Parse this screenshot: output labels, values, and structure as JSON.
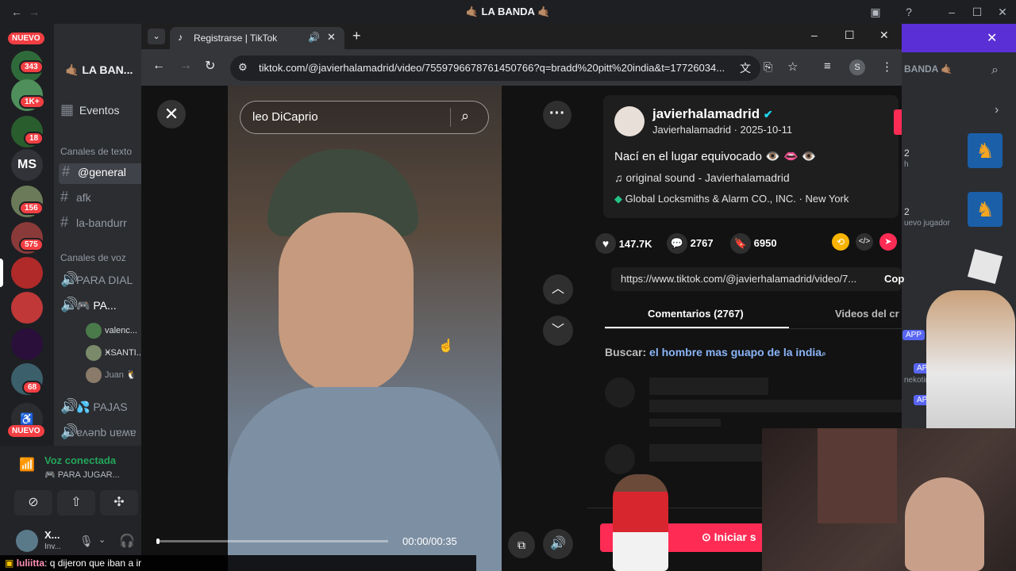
{
  "discord": {
    "title": "🤙🏽 LA BANDA 🤙🏽",
    "server_rail": {
      "nuevo_top": "NUEVO",
      "nuevo_bottom": "NUEVO",
      "badges": [
        "343",
        "1K+",
        "18",
        "156",
        "575",
        "68"
      ],
      "ms_label": "MS"
    },
    "sidebar": {
      "server_name": "🤙🏽 LA BAN...",
      "events": "Eventos",
      "text_category": "Canales de texto",
      "text_channels": [
        "@general",
        "afk",
        "la-bandurr"
      ],
      "voice_category": "Canales de voz",
      "voice_channels": [
        "PARA DIAL",
        "🎮 PA...",
        "💦 PAJAS",
        "ɐʌǝnb uɐʍɐ"
      ],
      "voice_users": [
        "valenc...",
        "ӾSANTI...",
        "Juan 🐧"
      ],
      "voice_connected": "Voz conectada",
      "voice_channel_sub": "🎮 PARA JUGAR...",
      "user_name": "X...",
      "user_status": "Inv..."
    },
    "right": {
      "banner": "BANDA 🤙🏽",
      "items": [
        "2",
        "h",
        "2",
        "uevo jugador",
        "nekotina.c..."
      ],
      "app_tags": [
        "APP",
        "APP",
        "APP"
      ]
    }
  },
  "browser": {
    "tab_title": "Registrarse | TikTok",
    "url": "tiktok.com/@javierhalamadrid/video/7559796678761450766?q=bradd%20pitt%20india&t=17726034...",
    "profile_initial": "S"
  },
  "tiktok": {
    "search_text": "leo DiCaprio",
    "timecode": "00:00/00:35",
    "username": "javierhalamadrid",
    "handle_date": "Javierhalamadrid · 2025-10-11",
    "caption": "Nací en el lugar equivocado 👁️ 👄 👁️",
    "sound": "original sound - Javierhalamadrid",
    "location": "Global Locksmiths & Alarm CO., INC. · New York",
    "likes": "147.7K",
    "comments": "2767",
    "saves": "6950",
    "share_url": "https://www.tiktok.com/@javierhalamadrid/video/7...",
    "copy_label": "Cop",
    "tab_comments": "Comentarios (2767)",
    "tab_videos": "Videos del cr",
    "search_prefix": "Buscar:",
    "search_suggestion": "el hombre mas guapo de la india",
    "live_button": "Iniciar s"
  },
  "chat": {
    "user": "luliitta",
    "message": ": q dijeron que iban a ir"
  },
  "colors": {
    "discord_bg": "#1e1f22",
    "discord_accent": "#5b2fd6",
    "tiktok_red": "#fe2c55",
    "verified": "#20d5ec",
    "link_blue": "#8ab4f8"
  }
}
